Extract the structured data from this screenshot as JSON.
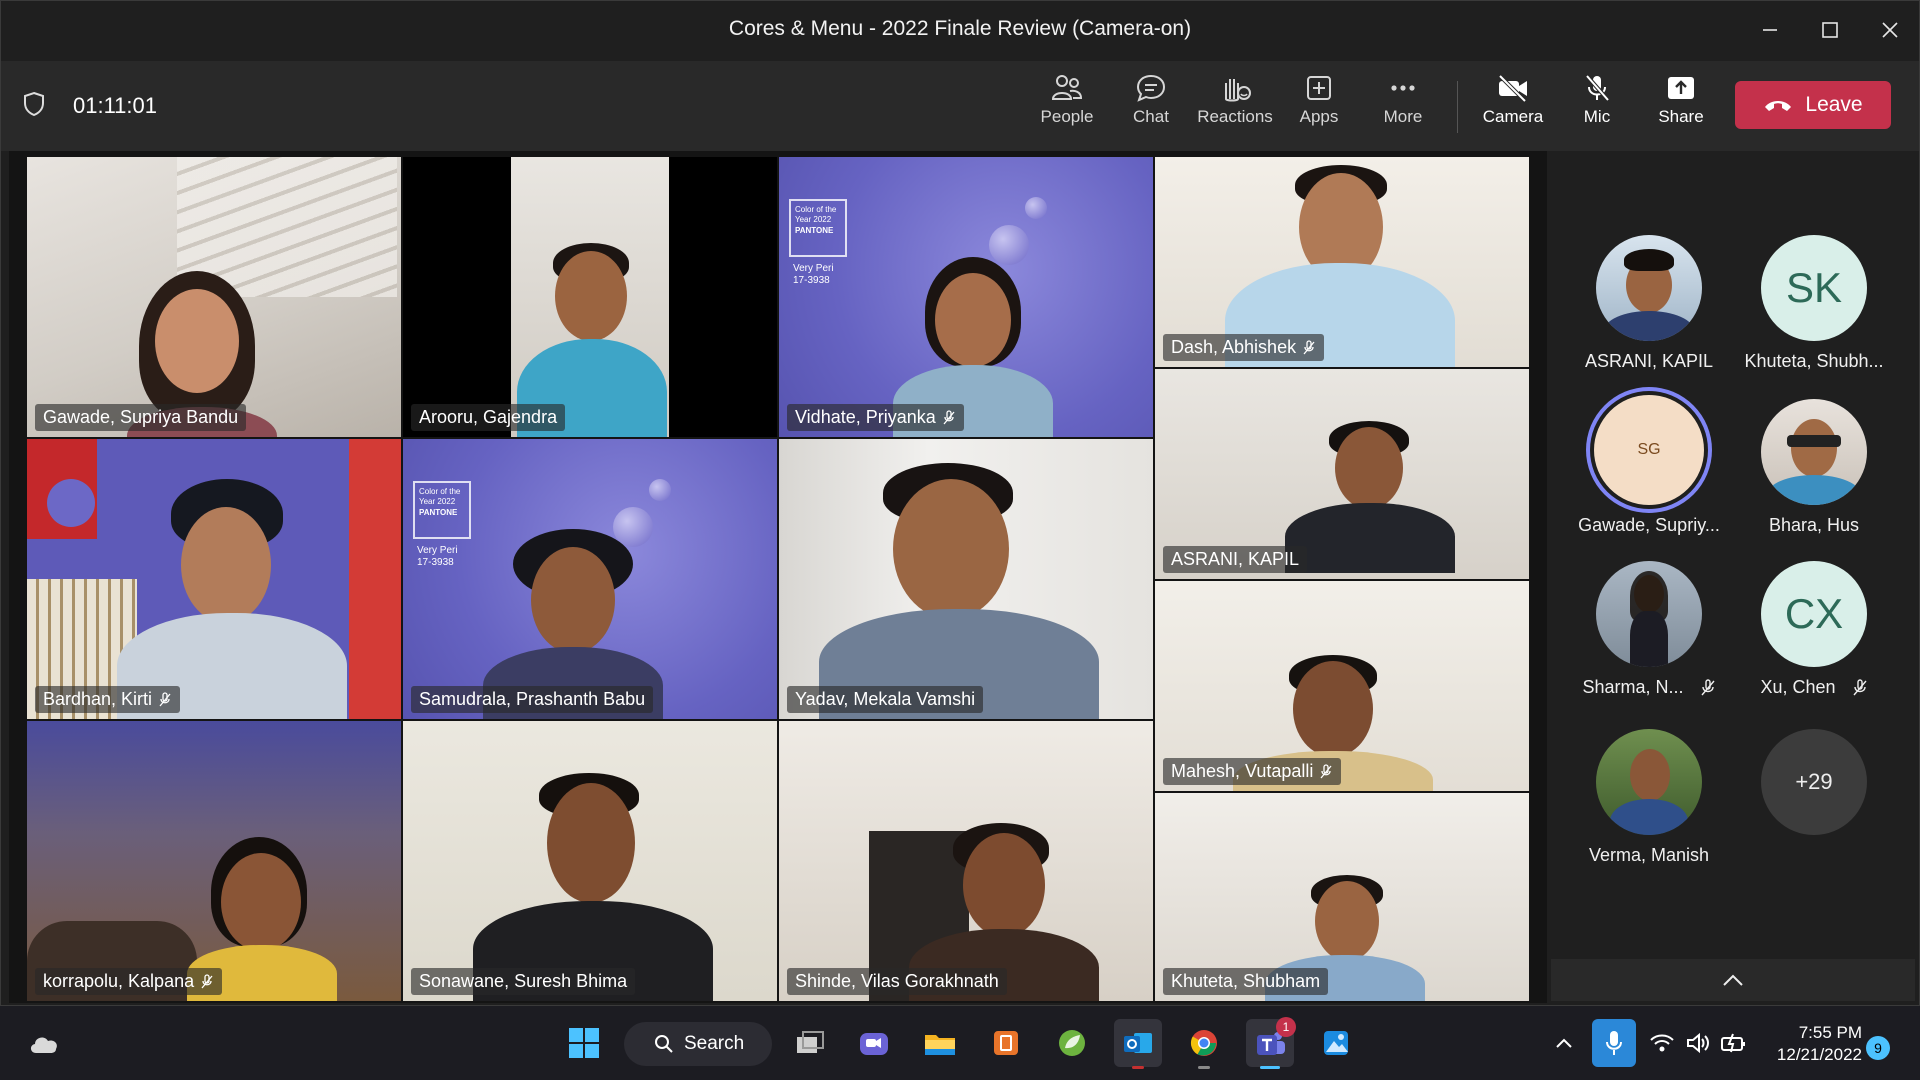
{
  "window": {
    "title": "Cores & Menu - 2022 Finale Review (Camera-on)"
  },
  "toolbar": {
    "timer": "01:11:01",
    "people": "People",
    "chat": "Chat",
    "reactions": "Reactions",
    "apps": "Apps",
    "more": "More",
    "camera": "Camera",
    "mic": "Mic",
    "share": "Share",
    "leave": "Leave"
  },
  "tiles": [
    {
      "name": "Gawade, Supriya Bandu",
      "muted": false
    },
    {
      "name": "Arooru, Gajendra",
      "muted": false
    },
    {
      "name": "Vidhate, Priyanka",
      "muted": true
    },
    {
      "name": "Dash, Abhishek",
      "muted": true
    },
    {
      "name": "Bardhan, Kirti",
      "muted": true
    },
    {
      "name": "Samudrala, Prashanth Babu",
      "muted": false
    },
    {
      "name": "Yadav, Mekala Vamshi",
      "muted": false
    },
    {
      "name": "ASRANI, KAPIL",
      "muted": false
    },
    {
      "name": "Mahesh, Vutapalli",
      "muted": true
    },
    {
      "name": "korrapolu, Kalpana",
      "muted": true
    },
    {
      "name": "Sonawane, Suresh Bhima",
      "muted": false
    },
    {
      "name": "Shinde, Vilas Gorakhnath",
      "muted": false
    },
    {
      "name": "Khuteta, Shubham",
      "muted": false
    }
  ],
  "pantone": {
    "line1": "Color of the Year 2022",
    "brand": "PANTONE",
    "name": "Very Peri",
    "code": "17-3938"
  },
  "roster": [
    {
      "name": "ASRANI, KAPIL",
      "initials": "",
      "muted": false
    },
    {
      "name": "Khuteta, Shubh...",
      "initials": "SK",
      "muted": false
    },
    {
      "name": "Gawade, Supriy...",
      "initials": "SG",
      "muted": false
    },
    {
      "name": "Bhara, Hus",
      "initials": "",
      "muted": false
    },
    {
      "name": "Sharma, N...",
      "initials": "",
      "muted": true
    },
    {
      "name": "Xu, Chen",
      "initials": "CX",
      "muted": true
    },
    {
      "name": "Verma, Manish",
      "initials": "",
      "muted": false
    },
    {
      "name": "",
      "initials": "+29",
      "muted": false
    }
  ],
  "taskbar": {
    "search": "Search",
    "time": "7:55 PM",
    "date": "12/21/2022",
    "notifications": "9",
    "teams_badge": "1"
  },
  "colors": {
    "accent": "#7f85f5",
    "leave": "#c4314b",
    "peri": "#6b68c9"
  }
}
